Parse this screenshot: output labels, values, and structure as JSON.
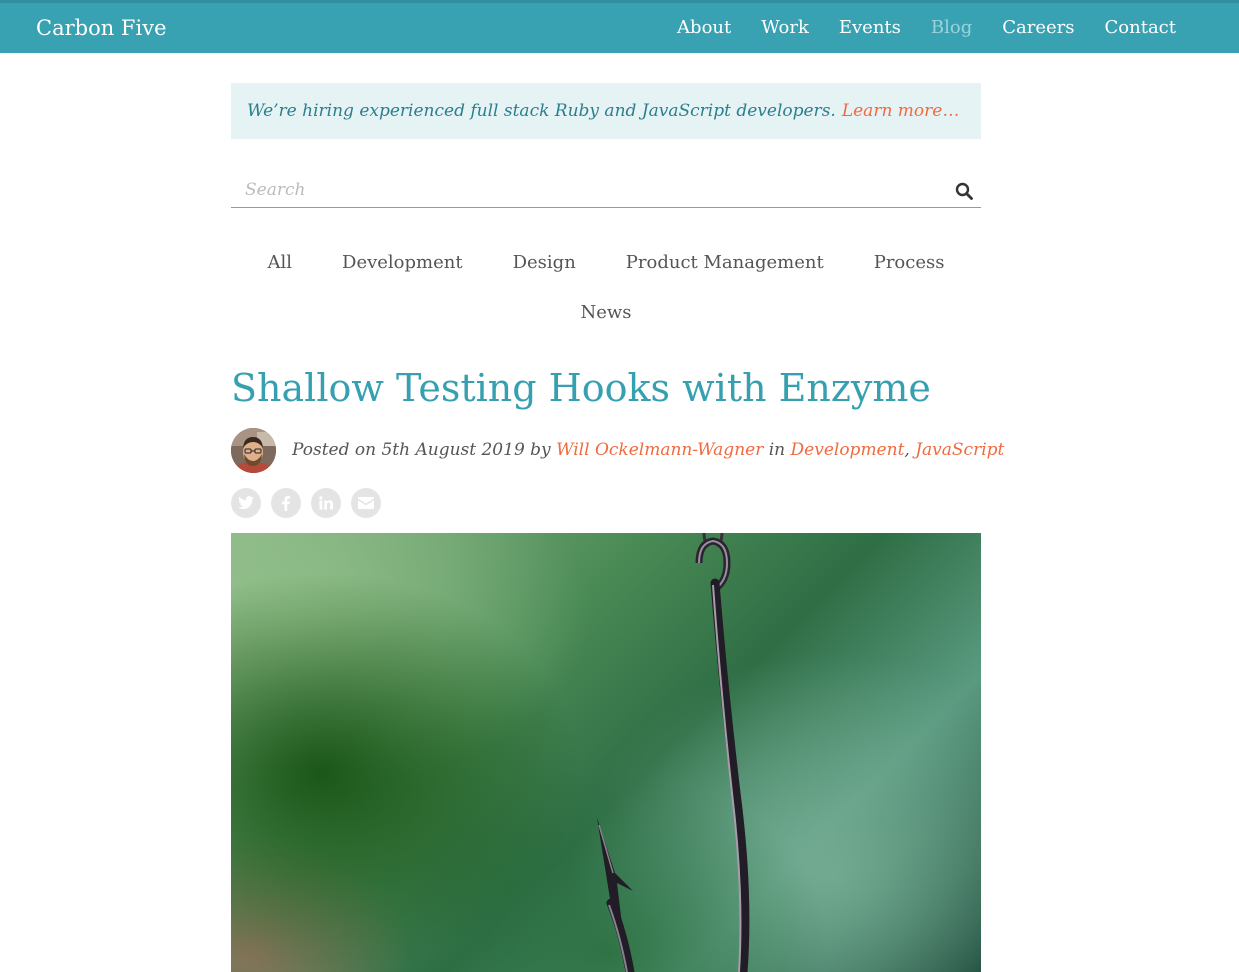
{
  "header": {
    "brand": "Carbon Five",
    "nav": [
      {
        "label": "About"
      },
      {
        "label": "Work"
      },
      {
        "label": "Events"
      },
      {
        "label": "Blog"
      },
      {
        "label": "Careers"
      },
      {
        "label": "Contact"
      }
    ],
    "active_nav": "Blog",
    "color": "#38a2b2"
  },
  "banner": {
    "text": "We’re hiring experienced full stack Ruby and JavaScript developers.",
    "link": "Learn more…",
    "link_color": "#f16a3f"
  },
  "search": {
    "placeholder": "Search",
    "icon": "search-icon"
  },
  "categories": {
    "row1": [
      "All",
      "Development",
      "Design",
      "Product Management",
      "Process"
    ],
    "row2": [
      "News"
    ]
  },
  "post": {
    "title": "Shallow Testing Hooks with Enzyme",
    "meta_prefix": "Posted on 5th August 2019 by",
    "author": "Will Ockelmann-Wagner",
    "meta_in": "in",
    "categories": [
      "Development",
      "JavaScript"
    ],
    "separator": ",",
    "title_color": "#36a0b1"
  },
  "share": {
    "icons": [
      "twitter-icon",
      "facebook-icon",
      "linkedin-icon",
      "email-icon"
    ]
  }
}
